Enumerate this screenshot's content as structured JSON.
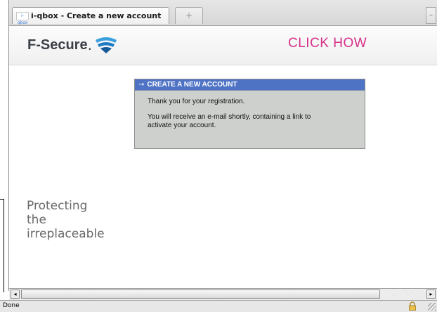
{
  "browser": {
    "tab_title": "i-qbox - Create a new account",
    "tab_favicon_text": "i-qbox",
    "new_tab_symbol": "+",
    "tab_menu_symbol": "–"
  },
  "header": {
    "logo_text": "F-Secure",
    "logo_dot": ".",
    "click_how": "CLICK HOW",
    "click_how_color": "#d6318a"
  },
  "panel": {
    "title": "CREATE A NEW ACCOUNT",
    "title_arrow": "→",
    "line1": "Thank you for your registration.",
    "line2": "You will receive an e-mail shortly, containing a link to",
    "line3": "activate your account.",
    "header_color": "#4e72c4"
  },
  "tagline": {
    "line1": "Protecting",
    "line2": "the",
    "line3": "irreplaceable"
  },
  "scrollbar": {
    "left_arrow": "◂",
    "right_arrow": "▸"
  },
  "status": {
    "text": "Done",
    "icon": "lock-icon"
  }
}
